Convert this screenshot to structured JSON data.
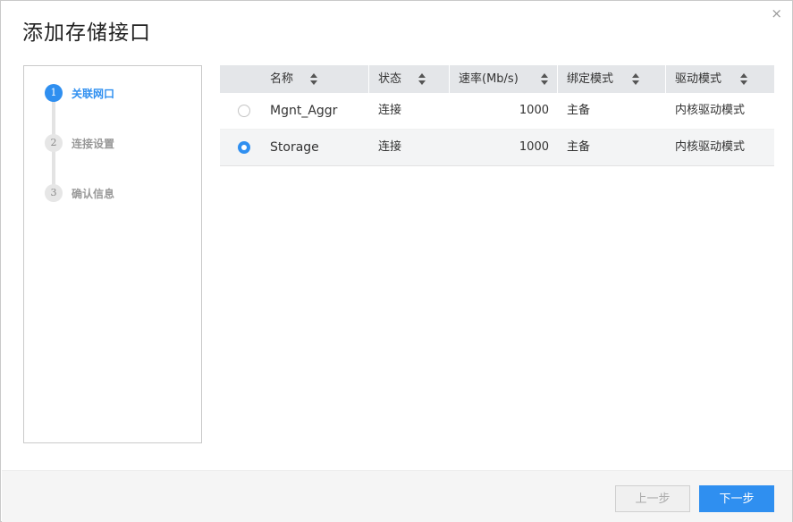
{
  "dialog": {
    "title": "添加存储接口",
    "close_glyph": "×"
  },
  "steps": [
    {
      "number": "1",
      "label": "关联网口",
      "active": true
    },
    {
      "number": "2",
      "label": "连接设置",
      "active": false
    },
    {
      "number": "3",
      "label": "确认信息",
      "active": false
    }
  ],
  "table": {
    "columns": [
      "名称",
      "状态",
      "速率(Mb/s)",
      "绑定模式",
      "驱动模式"
    ],
    "rows": [
      {
        "selected": false,
        "name": "Mgnt_Aggr",
        "status": "连接",
        "speed": "1000",
        "bond_mode": "主备",
        "driver_mode": "内核驱动模式"
      },
      {
        "selected": true,
        "name": "Storage",
        "status": "连接",
        "speed": "1000",
        "bond_mode": "主备",
        "driver_mode": "内核驱动模式"
      }
    ]
  },
  "footer": {
    "prev_label": "上一步",
    "next_label": "下一步"
  },
  "colors": {
    "accent": "#2f8ff0",
    "header_bg": "#e4e6e9",
    "selected_row_bg": "#f3f4f5"
  },
  "icons": {
    "close": "close-icon",
    "sort": "sort-icon"
  }
}
